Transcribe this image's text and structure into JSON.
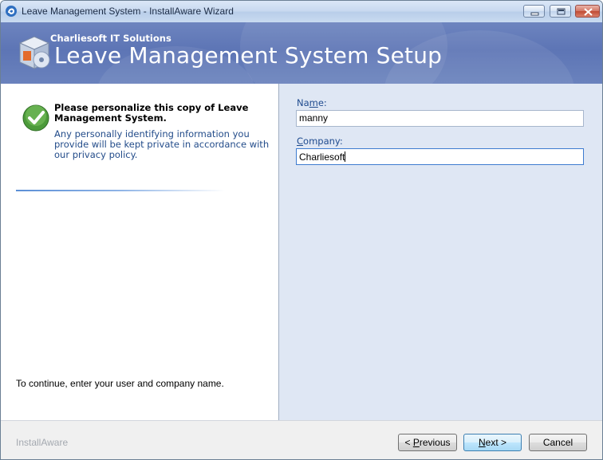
{
  "window": {
    "title": "Leave Management System - InstallAware Wizard"
  },
  "banner": {
    "company": "Charliesoft IT Solutions",
    "title": "Leave Management System Setup",
    "icon": "setup-box-icon"
  },
  "left": {
    "heading": "Please personalize this copy of Leave Management System.",
    "description": "Any personally identifying information you provide will be kept private in accordance with our privacy policy.",
    "instruction": "To continue, enter your user and company name.",
    "icon": "checkmark-icon"
  },
  "form": {
    "name_label_pre": "Na",
    "name_label_key": "m",
    "name_label_post": "e:",
    "name_value": "manny",
    "company_label_key": "C",
    "company_label_post": "ompany:",
    "company_value": "Charliesoft"
  },
  "footer": {
    "brand": "InstallAware",
    "previous_prefix": "< ",
    "previous_key": "P",
    "previous_rest": "revious",
    "next_key": "N",
    "next_rest": "ext >",
    "cancel_label": "Cancel"
  },
  "colors": {
    "banner": "#5d75b5",
    "right_panel": "#dfe7f4",
    "label_blue": "#1e4a8e",
    "footer_brand": "#a4a9b0"
  }
}
